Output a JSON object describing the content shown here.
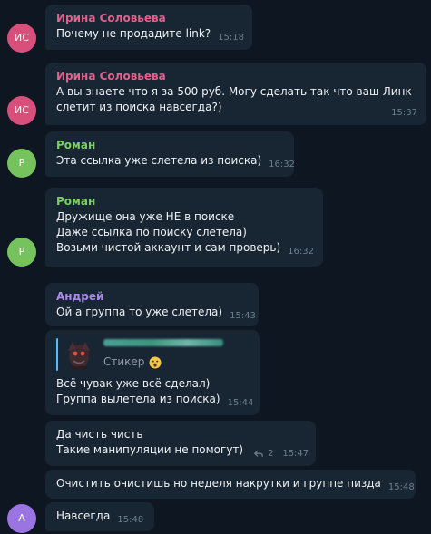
{
  "colors": {
    "background": "#0e1621",
    "bubble": "#182533",
    "time": "#6d7f8f",
    "avatar_irina": "#d94f7c",
    "avatar_roman": "#76c25c",
    "avatar_andrey": "#9a74e0",
    "name_irina": "#e0628e",
    "name_roman": "#7ccf64",
    "name_andrey": "#a98ae6",
    "reply_bar": "#5fb8ff"
  },
  "messages": [
    {
      "sender": "Ирина Соловьева",
      "avatar": "ИС",
      "lines": [
        "Почему не продадите link?"
      ],
      "time": "15:18"
    },
    {
      "sender": "Ирина Соловьева",
      "avatar": "ИС",
      "lines": [
        "А вы знаете что я за 500 руб. Могу сделать так что ваш Линк",
        "слетит из поиска навсегда?)"
      ],
      "time": "15:37"
    },
    {
      "sender": "Роман",
      "avatar": "Р",
      "lines": [
        "Эта ссылка уже слетела из поиска)"
      ],
      "time": "16:32"
    },
    {
      "sender": "Роман",
      "avatar": "Р",
      "lines": [
        "Дружище она уже НЕ в поиске",
        "Даже ссылка по поиску слетела)",
        "Возьми чистой аккаунт и сам проверь)"
      ],
      "time": "16:32"
    },
    {
      "sender": "Андрей",
      "lines": [
        "Ой а группа то уже слетела)"
      ],
      "time": "15:43"
    },
    {
      "reply": {
        "label": "Стикер",
        "emoji_icon": "astonished-face-icon",
        "thumbnail_icon": "sticker-thumbnail-icon"
      },
      "lines": [
        "Всё чувак уже всё сделал)",
        "Группа вылетела из поиска)"
      ],
      "time": "15:44"
    },
    {
      "lines": [
        "Да чисть чисть",
        "Такие манипуляции не помогут)"
      ],
      "reply_icon": "reply-arrow-icon",
      "replies": "2",
      "time": "15:47"
    },
    {
      "lines": [
        "Очистить очистишь но неделя накрутки и группе пизда"
      ],
      "time": "15:48"
    },
    {
      "avatar": "А",
      "lines": [
        "Навсегда"
      ],
      "time": "15:48"
    }
  ]
}
